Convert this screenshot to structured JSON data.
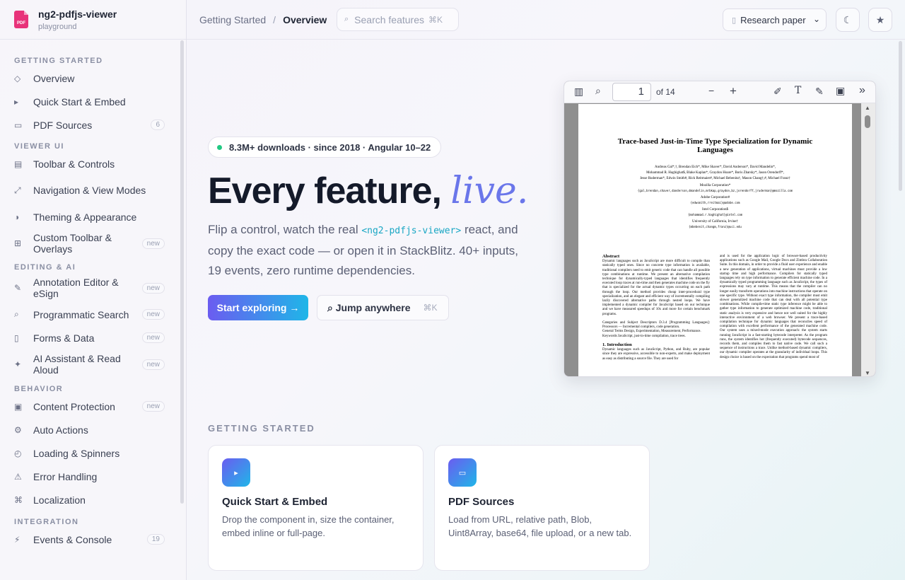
{
  "brand": {
    "name": "ng2-pdfjs-viewer",
    "sub": "playground",
    "logo_text": "PDF"
  },
  "sidebar": {
    "sections": [
      {
        "title": "GETTING STARTED",
        "items": [
          {
            "icon": "◇",
            "label": "Overview"
          },
          {
            "icon": "▸",
            "label": "Quick Start & Embed"
          },
          {
            "icon": "▭",
            "label": "PDF Sources",
            "badge": "6"
          }
        ]
      },
      {
        "title": "VIEWER UI",
        "items": [
          {
            "icon": "▤",
            "label": "Toolbar & Controls"
          },
          {
            "icon": "⤢",
            "label": "Navigation & View Modes"
          },
          {
            "icon": "◑",
            "label": "Theming & Appearance"
          },
          {
            "icon": "⊞",
            "label": "Custom Toolbar & Overlays",
            "badge": "new"
          }
        ]
      },
      {
        "title": "EDITING & AI",
        "items": [
          {
            "icon": "✎",
            "label": "Annotation Editor & eSign",
            "badge": "new"
          },
          {
            "icon": "⌕",
            "label": "Programmatic Search",
            "badge": "new"
          },
          {
            "icon": "▯",
            "label": "Forms & Data",
            "badge": "new"
          },
          {
            "icon": "✦",
            "label": "AI Assistant & Read Aloud",
            "badge": "new"
          }
        ]
      },
      {
        "title": "BEHAVIOR",
        "items": [
          {
            "icon": "▣",
            "label": "Content Protection",
            "badge": "new"
          },
          {
            "icon": "⚙",
            "label": "Auto Actions"
          },
          {
            "icon": "◴",
            "label": "Loading & Spinners"
          },
          {
            "icon": "⚠",
            "label": "Error Handling"
          },
          {
            "icon": "⌘",
            "label": "Localization"
          }
        ]
      },
      {
        "title": "INTEGRATION",
        "items": [
          {
            "icon": "⚡",
            "label": "Events & Console",
            "badge": "19"
          }
        ]
      }
    ]
  },
  "topbar": {
    "breadcrumb": [
      "Getting Started",
      "Overview"
    ],
    "search_placeholder": "Search features",
    "search_kbd": "⌘K",
    "doc_select": "Research paper",
    "theme_icon": "☾",
    "star_icon": "★"
  },
  "hero": {
    "pill": "8.3M+ downloads · since 2018 · Angular 10–22",
    "title_main": "Every feature,",
    "title_accent": "live.",
    "sub_before": "Flip a control, watch the real ",
    "sub_code": "<ng2-pdfjs-viewer>",
    "sub_after": " react, and copy the exact code — or open it in StackBlitz. 40+ inputs, 19 events, zero runtime dependencies.",
    "cta": "Start exploring →",
    "jump": "⌕ Jump anywhere",
    "jump_kbd": "⌘K"
  },
  "viewer": {
    "page": "1",
    "of": "of 14",
    "paper": {
      "title": "Trace-based Just-in-Time Type Specialization for Dynamic Languages",
      "authors1": "Andreas Gal*,†, Brendan Eich*, Mike Shaver*, David Anderson*, David Mandelin*,",
      "authors2": "Mohammad R. Haghighat$, Blake Kaplan*, Graydon Hoare*, Boris Zbarsky*, Jason Orendorff*,",
      "authors3": "Jesse Ruderman*, Edwin Smith#, Rick Reitmaier#, Michael Bebenita†, Mason Chang†,#, Michael Franz†",
      "aff1": "Mozilla Corporation*",
      "aff1b": "{gal,brendan,shaver,danderson,dmandelin,mrbkap,graydon,bz,jorendorff,jruderman}@mozilla.com",
      "aff2": "Adobe Corporation#",
      "aff2b": "{edwsmith,rreitmai}@adobe.com",
      "aff3": "Intel Corporation$",
      "aff3b": "{mohammad.r.haghighat}@intel.com",
      "aff4": "University of California, Irvine†",
      "aff4b": "{mbebenit,changm,franz}@uci.edu",
      "abstract_h": "Abstract",
      "abstract": "Dynamic languages such as JavaScript are more difficult to compile than statically typed ones. Since no concrete type information is available, traditional compilers need to emit generic code that can handle all possible type combinations at runtime. We present an alternative compilation technique for dynamically-typed languages that identifies frequently executed loop traces at run-time and then generates machine code on the fly that is specialized for the actual dynamic types occurring on each path through the loop. Our method provides cheap inter-procedural type specialization, and an elegant and efficient way of incrementally compiling lazily discovered alternative paths through nested loops. We have implemented a dynamic compiler for JavaScript based on our technique and we have measured speedups of 10x and more for certain benchmark programs.",
      "cats": "Categories and Subject Descriptors D.3.4 [Programming Languages]: Processors — Incremental compilers, code generation.",
      "terms": "General Terms Design, Experimentation, Measurement, Performance.",
      "keywords": "Keywords JavaScript, just-in-time compilation, trace trees.",
      "intro_h": "1. Introduction",
      "intro": "Dynamic languages such as JavaScript, Python, and Ruby, are popular since they are expressive, accessible to non-experts, and make deployment as easy as distributing a source file. They are used for",
      "col2": "and is used for the application logic of browser-based productivity applications such as Google Mail, Google Docs and Zimbra Collaboration Suite. In this domain, in order to provide a fluid user experience and enable a new generation of applications, virtual machines must provide a low startup time and high performance. Compilers for statically typed languages rely on type information to generate efficient machine code. In a dynamically typed programming language such as JavaScript, the types of expressions may vary at runtime. This means that the compiler can no longer easily transform operations into machine instructions that operate on one specific type. Without exact type information, the compiler must emit slower generalized machine code that can deal with all potential type combinations. While compile-time static type inference might be able to gather type information to generate optimized machine code, traditional static analysis is very expensive and hence not well suited for the highly interactive environment of a web browser. We present a trace-based compilation technique for dynamic languages that reconciles speed of compilation with excellent performance of the generated machine code. Our system uses a mixed-mode execution approach: the system starts running JavaScript in a fast-starting bytecode interpreter. As the program runs, the system identifies hot (frequently executed) bytecode sequences, records them, and compiles them to fast native code. We call such a sequence of instructions a trace. Unlike method-based dynamic compilers, our dynamic compiler operates at the granularity of individual loops. This design choice is based on the expectation that programs spend most of"
    }
  },
  "getting_started": {
    "heading": "GETTING STARTED",
    "cards": [
      {
        "icon": "▸",
        "title": "Quick Start & Embed",
        "desc": "Drop the component in, size the container, embed inline or full-page."
      },
      {
        "icon": "▭",
        "title": "PDF Sources",
        "desc": "Load from URL, relative path, Blob, Uint8Array, base64, file upload, or a new tab."
      }
    ]
  }
}
